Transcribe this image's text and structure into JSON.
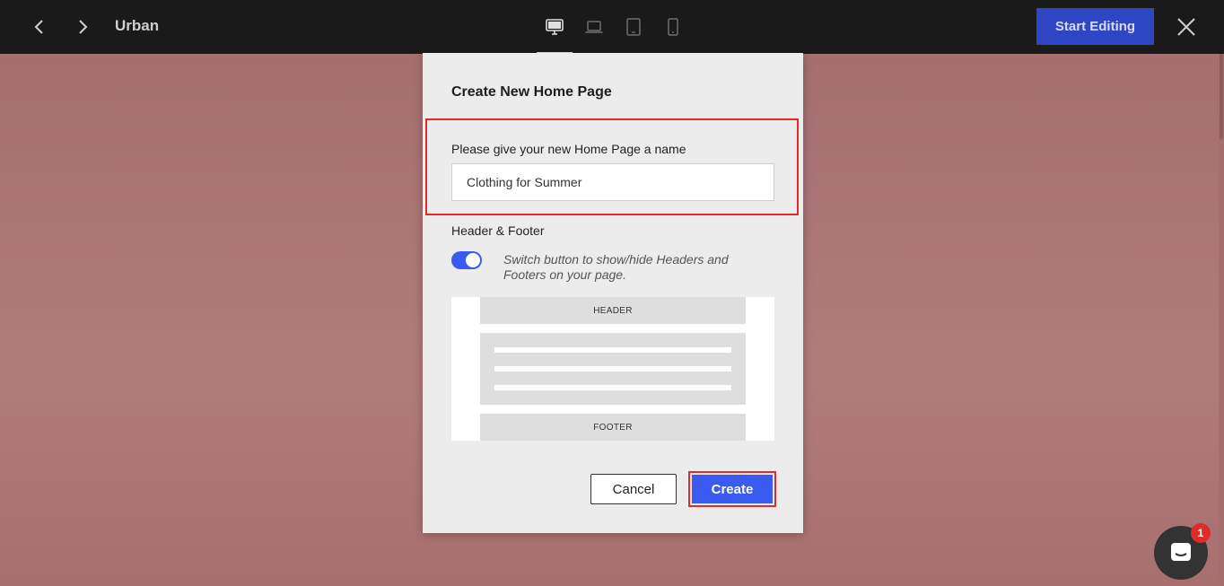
{
  "topbar": {
    "site_name": "Urban",
    "start_editing_label": "Start Editing",
    "devices": [
      "desktop-icon",
      "laptop-icon",
      "tablet-icon",
      "mobile-icon"
    ],
    "active_device": "desktop"
  },
  "modal": {
    "title": "Create New Home Page",
    "name_label": "Please give your new Home Page a name",
    "name_value": "Clothing for Summer",
    "hf_label": "Header & Footer",
    "toggle_on": true,
    "toggle_help": "Switch button to show/hide Headers and Footers on your page.",
    "preview_header": "HEADER",
    "preview_footer": "FOOTER",
    "cancel_label": "Cancel",
    "create_label": "Create"
  },
  "chat": {
    "badge_count": "1"
  },
  "colors": {
    "accent": "#3b5bf0",
    "start_button": "#2f46c4",
    "highlight": "#e02b2b",
    "topbar": "#1a1a1a",
    "background": "#a77070"
  }
}
